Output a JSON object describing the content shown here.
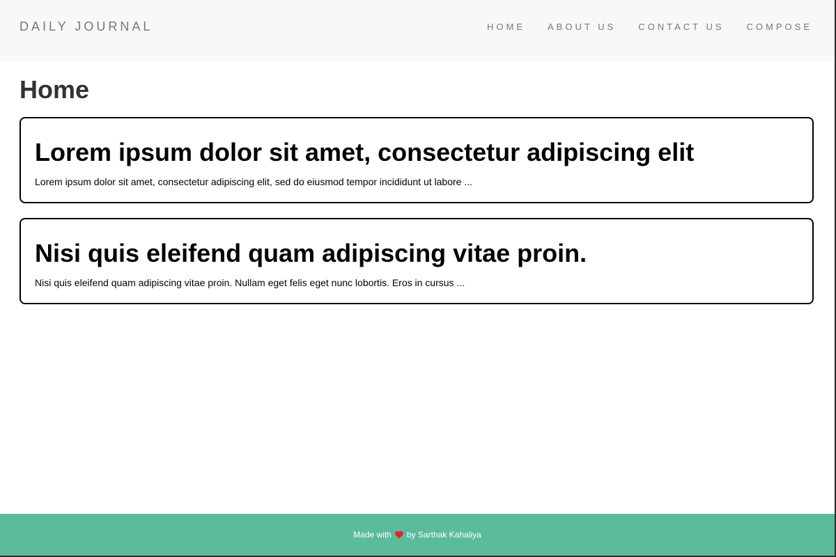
{
  "header": {
    "brand": "DAILY JOURNAL",
    "nav": [
      {
        "label": "HOME"
      },
      {
        "label": "ABOUT US"
      },
      {
        "label": "CONTACT US"
      },
      {
        "label": "COMPOSE"
      }
    ]
  },
  "main": {
    "title": "Home",
    "posts": [
      {
        "title": "Lorem ipsum dolor sit amet, consectetur adipiscing elit",
        "excerpt": "Lorem ipsum dolor sit amet, consectetur adipiscing elit, sed do eiusmod tempor incididunt ut labore ..."
      },
      {
        "title": "Nisi quis eleifend quam adipiscing vitae proin.",
        "excerpt": "Nisi quis eleifend quam adipiscing vitae proin. Nullam eget felis eget nunc lobortis. Eros in cursus ..."
      }
    ]
  },
  "footer": {
    "prefix": "Made with",
    "icon": "heart-icon",
    "suffix": "by Sarthak Kahaliya",
    "color": "#5bbb9c"
  },
  "colors": {
    "navbar_bg": "#f8f8f8",
    "nav_text": "#777777",
    "heart": "#e0242c"
  }
}
